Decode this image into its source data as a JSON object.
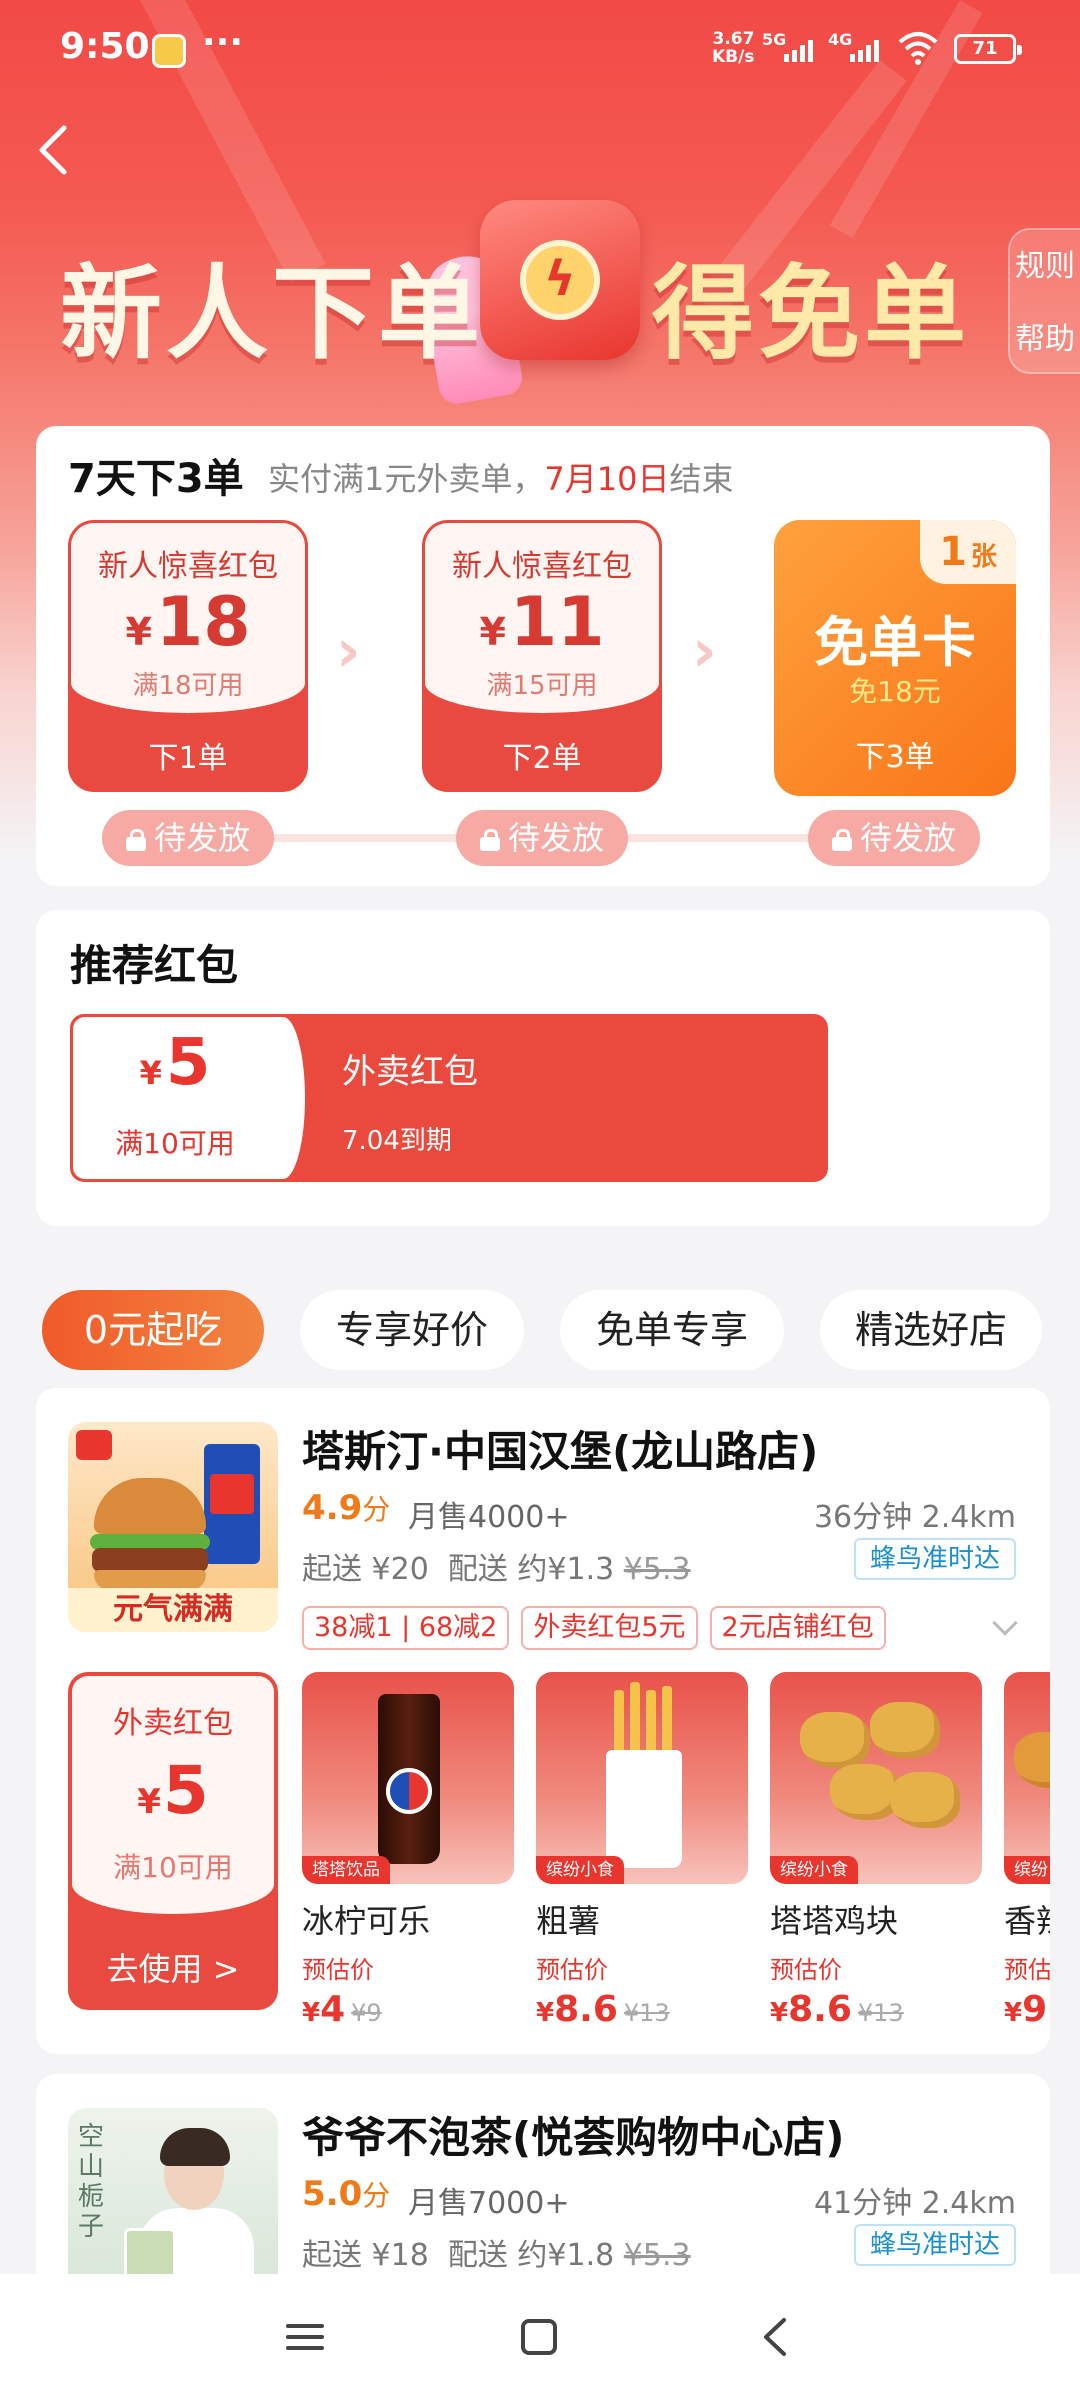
{
  "status_bar": {
    "time": "9:50",
    "net_speed_value": "3.67",
    "net_speed_unit": "KB/s",
    "sim1": "5G",
    "sim2": "4G",
    "battery": "71"
  },
  "header": {
    "title_left": "新人下单",
    "title_right": "得免单",
    "side_rule": "规则",
    "side_help": "帮助"
  },
  "task": {
    "title": "7天下3单",
    "subtitle_prefix": "实付满1元外卖单，",
    "subtitle_date": "7月10日",
    "subtitle_suffix": "结束",
    "steps": [
      {
        "name": "新人惊喜红包",
        "currency": "¥",
        "amount": "18",
        "condition": "满18可用",
        "order": "下1单",
        "status": "待发放"
      },
      {
        "name": "新人惊喜红包",
        "currency": "¥",
        "amount": "11",
        "condition": "满15可用",
        "order": "下2单",
        "status": "待发放"
      }
    ],
    "free_card": {
      "count": "1",
      "unit": "张",
      "title": "免单卡",
      "subtitle": "免18元",
      "order": "下3单",
      "status": "待发放"
    }
  },
  "recommended": {
    "title": "推荐红包",
    "coupon": {
      "currency": "¥",
      "amount": "5",
      "condition": "满10可用",
      "name": "外卖红包",
      "expiry": "7.04到期"
    }
  },
  "filters": {
    "items": [
      "0元起吃",
      "专享好价",
      "免单专享",
      "精选好店"
    ],
    "active_index": 0
  },
  "stores": [
    {
      "name": "塔斯汀·中国汉堡(龙山路店)",
      "rating": "4.9",
      "rating_unit": "分",
      "sales": "月售4000+",
      "distance": "36分钟 2.4km",
      "min_order": "起送 ¥20",
      "delivery": "配送 约¥1.3",
      "delivery_orig": "¥5.3",
      "badge": "蜂鸟准时达",
      "thumb_tag": "元气满满",
      "promos": [
        "38减1",
        "68减2",
        "外卖红包5元",
        "2元店铺红包"
      ],
      "coupon": {
        "name": "外卖红包",
        "currency": "¥",
        "amount": "5",
        "condition": "满10可用",
        "action": "去使用 >"
      },
      "products": [
        {
          "name": "冰柠可乐",
          "tag": "塔塔饮品",
          "est_label": "预估价",
          "price": "4",
          "orig": "¥9"
        },
        {
          "name": "粗薯",
          "tag": "缤纷小食",
          "est_label": "预估价",
          "price": "8.6",
          "orig": "¥13"
        },
        {
          "name": "塔塔鸡块",
          "tag": "缤纷小食",
          "est_label": "预估价",
          "price": "8.6",
          "orig": "¥13"
        },
        {
          "name": "香辣",
          "tag": "缤纷",
          "est_label": "预估",
          "price": "9",
          "orig": ""
        }
      ]
    },
    {
      "name": "爷爷不泡茶(悦荟购物中心店)",
      "rating": "5.0",
      "rating_unit": "分",
      "sales": "月售7000+",
      "distance": "41分钟 2.4km",
      "min_order": "起送 ¥18",
      "delivery": "配送 约¥1.8",
      "delivery_orig": "¥5.3",
      "badge": "蜂鸟准时达",
      "thumb_text": "空山栀子"
    }
  ],
  "colors": {
    "primary": "#e8352e",
    "orange": "#f07a19",
    "badge_blue": "#1b8fd0"
  },
  "icons": {
    "back": "chevron-left-icon",
    "lock": "lock-icon",
    "nav": [
      "menu-icon",
      "home-square-icon",
      "back-triangle-icon"
    ]
  }
}
